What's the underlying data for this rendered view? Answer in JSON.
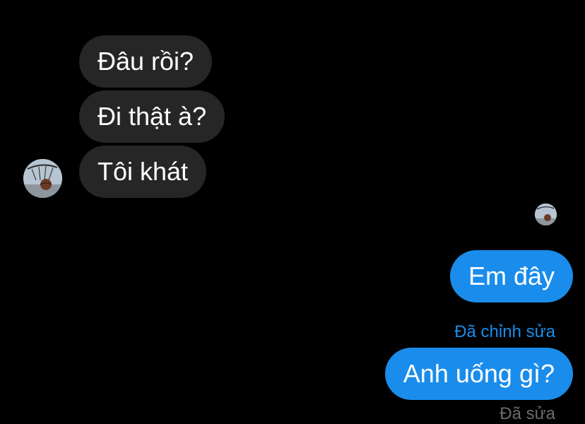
{
  "conversation": {
    "incoming": [
      {
        "text": "Đâu rồi?"
      },
      {
        "text": "Đi thật à?"
      },
      {
        "text": "Tôi khát"
      }
    ],
    "outgoing": [
      {
        "text": "Em đây"
      },
      {
        "text": "Anh uống gì?"
      }
    ],
    "edited_label": "Đã chỉnh sửa",
    "bottom_status_partial": "Đã sửa"
  },
  "colors": {
    "background": "#000000",
    "incoming_bubble": "#262626",
    "outgoing_bubble": "#1a8ceb",
    "edited_label": "#1a8ceb"
  },
  "icons": {
    "sender_avatar": "basketball-hoop-avatar",
    "seen_avatar": "basketball-hoop-avatar"
  }
}
